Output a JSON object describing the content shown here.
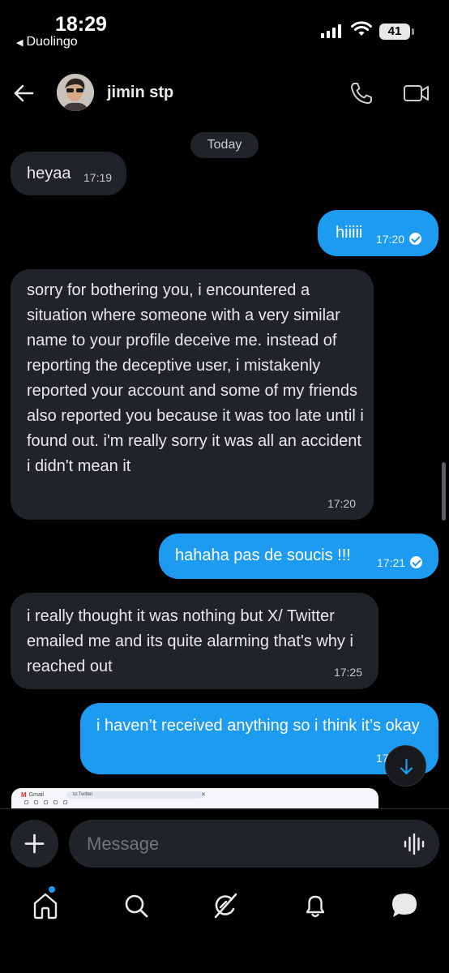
{
  "status": {
    "time": "18:29",
    "back_app": "Duolingo",
    "battery": "41",
    "signal_icon": "cellular-signal-icon",
    "wifi_icon": "wifi-icon"
  },
  "header": {
    "contact_name": "jimin stp",
    "back_icon": "arrow-left-icon",
    "call_icon": "phone-icon",
    "video_icon": "video-camera-icon"
  },
  "day_label": "Today",
  "messages": [
    {
      "dir": "in",
      "text": "heyaa",
      "time": "17:19"
    },
    {
      "dir": "out",
      "text": "hiiiii",
      "time": "17:20",
      "seen": true
    },
    {
      "dir": "in",
      "text": "sorry for bothering you, i encountered a situation where someone with a very similar name to your profile deceive me. instead of reporting the deceptive user, i mistakenly reported your account and some of my friends also reported you because it was too late until i found out. i'm really sorry it was all an accident i didn't mean it",
      "time": "17:20"
    },
    {
      "dir": "out",
      "text": "hahaha pas de soucis !!!",
      "time": "17:21",
      "seen": true
    },
    {
      "dir": "in",
      "text": "i really thought it was nothing but X/ Twitter emailed me and its quite alarming that's why i reached out",
      "time": "17:25"
    },
    {
      "dir": "out",
      "text": "i haven’t received anything so i think it’s okay",
      "time": "17"
    }
  ],
  "image_preview": {
    "app": "Gmail",
    "search": "to:Twitter"
  },
  "composer": {
    "placeholder": "Message",
    "plus_icon": "plus-icon",
    "voice_icon": "waveform-icon"
  },
  "tabs": [
    {
      "name": "home",
      "icon": "home-icon"
    },
    {
      "name": "search",
      "icon": "search-icon"
    },
    {
      "name": "grok",
      "icon": "grok-icon"
    },
    {
      "name": "notifications",
      "icon": "bell-icon"
    },
    {
      "name": "messages",
      "icon": "messages-icon"
    }
  ],
  "colors": {
    "background": "#000000",
    "accent": "#1d9bf0",
    "incoming_bubble": "#202327"
  }
}
